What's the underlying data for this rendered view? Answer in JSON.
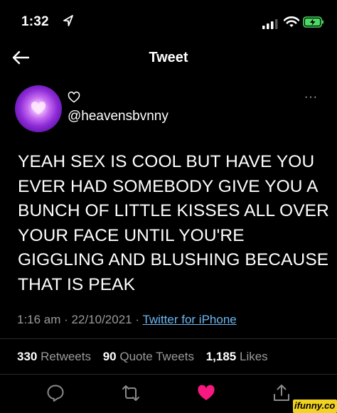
{
  "status_bar": {
    "time": "1:32",
    "location_icon": "location-arrow-icon",
    "signal_icon": "signal-icon",
    "wifi_icon": "wifi-icon",
    "battery_icon": "battery-charging-icon",
    "battery_color": "#4cd964"
  },
  "header": {
    "back_icon": "back-arrow-icon",
    "title": "Tweet"
  },
  "author": {
    "avatar_color": "#8d2bd6",
    "display_name_icon": "heart-outline-icon",
    "handle": "@heavensbvnny",
    "more_icon": "more-icon",
    "more_label": "···"
  },
  "tweet": {
    "text": "YEAH SEX IS COOL BUT HAVE YOU\nEVER HAD SOMEBODY GIVE YOU A\nBUNCH OF LITTLE KISSES ALL OVER\nYOUR FACE UNTIL YOU'RE\nGIGGLING AND BLUSHING BECAUSE\nTHAT IS PEAK"
  },
  "meta": {
    "time": "1:16 am",
    "separator": " · ",
    "date": "22/10/2021",
    "source": "Twitter for iPhone",
    "link_color": "#6cb7f2"
  },
  "stats": {
    "retweets_count": "330",
    "retweets_label": "Retweets",
    "quotes_count": "90",
    "quotes_label": "Quote Tweets",
    "likes_count": "1,185",
    "likes_label": "Likes"
  },
  "actions": {
    "reply_icon": "reply-icon",
    "retweet_icon": "retweet-icon",
    "like_icon": "heart-filled-icon",
    "like_color": "#f91880",
    "share_icon": "share-icon"
  },
  "watermark": {
    "text": "ifunny.co"
  }
}
